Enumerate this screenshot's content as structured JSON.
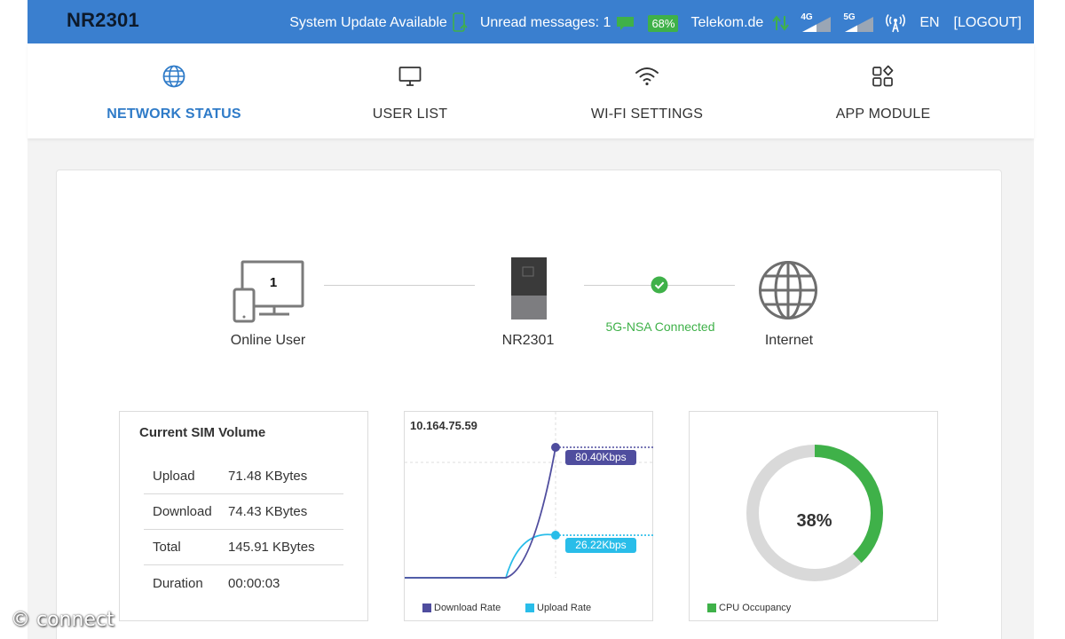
{
  "header": {
    "brand": "NR2301",
    "system_update": "System Update Available",
    "unread_messages": "Unread messages: 1",
    "battery": "68%",
    "operator": "Telekom.de",
    "net_4g": "4G",
    "net_5g": "5G",
    "language": "EN",
    "logout": "[LOGOUT]"
  },
  "nav": {
    "tabs": [
      {
        "label": "NETWORK STATUS",
        "icon": "globe-icon",
        "active": true
      },
      {
        "label": "USER LIST",
        "icon": "monitor-icon",
        "active": false
      },
      {
        "label": "WI-FI SETTINGS",
        "icon": "wifi-icon",
        "active": false
      },
      {
        "label": "APP MODULE",
        "icon": "apps-icon",
        "active": false
      }
    ]
  },
  "topology": {
    "online_user_count": "1",
    "online_user_label": "Online User",
    "device_label": "NR2301",
    "connection_status": "5G-NSA Connected",
    "internet_label": "Internet"
  },
  "sim_volume": {
    "title": "Current SIM Volume",
    "rows": [
      {
        "key": "Upload",
        "value": "71.48 KBytes"
      },
      {
        "key": "Download",
        "value": "74.43 KBytes"
      },
      {
        "key": "Total",
        "value": "145.91 KBytes"
      },
      {
        "key": "Duration",
        "value": "00:00:03"
      }
    ]
  },
  "rate_chart": {
    "ip": "10.164.75.59",
    "download_label": "80.40Kbps",
    "upload_label": "26.22Kbps",
    "legend_download": "Download Rate",
    "legend_upload": "Upload Rate"
  },
  "cpu": {
    "value_label": "38%",
    "legend": "CPU Occupancy"
  },
  "chart_data": [
    {
      "type": "line",
      "title": "10.164.75.59",
      "series": [
        {
          "name": "Download Rate",
          "values": [
            0,
            0,
            80.4
          ]
        },
        {
          "name": "Upload Rate",
          "values": [
            0,
            0,
            26.22
          ]
        }
      ]
    },
    {
      "type": "pie",
      "series": [
        {
          "name": "CPU Occupancy",
          "values": [
            38
          ]
        }
      ]
    }
  ],
  "watermark": "© connect",
  "colors": {
    "header_bg": "#3a7fcf",
    "active_tab": "#2f7bc8",
    "connected_green": "#3fb149",
    "download_series": "#4f4d9e",
    "upload_series": "#29bde9",
    "cpu_track": "#d9d9d9",
    "cpu_fill": "#3fb149"
  }
}
